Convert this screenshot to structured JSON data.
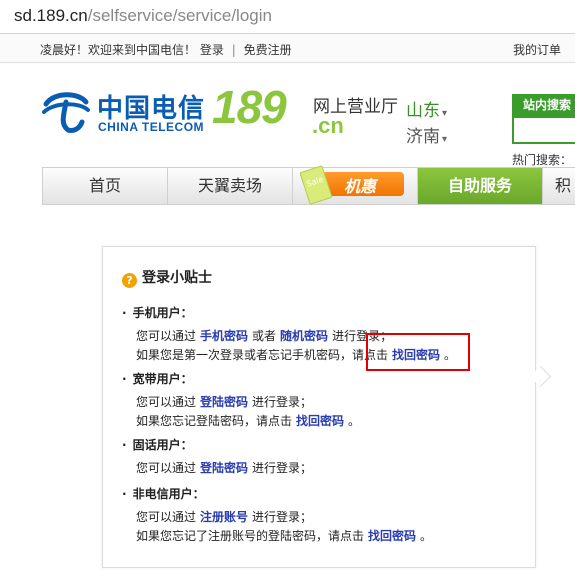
{
  "browser": {
    "host": "sd.189.cn",
    "path": "/selfservice/service/login"
  },
  "topbar": {
    "greeting": "凌晨好！欢迎来到中国电信！",
    "login": "登录",
    "separator": "|",
    "register": "免费注册",
    "my_orders": "我的订单"
  },
  "logo": {
    "cn_name": "中国电信",
    "en_name": "CHINA TELECOM",
    "number": "189",
    "hall": "网上营业厅",
    "domain": ".cn"
  },
  "location": {
    "province": "山东",
    "city": "济南"
  },
  "search": {
    "tab_label": "站内搜索",
    "hot_label": "热门搜索："
  },
  "nav": {
    "items": [
      "首页",
      "天翼卖场",
      "自助服务",
      "积"
    ],
    "promo": "机惠",
    "promo_card": "Sale"
  },
  "tips": {
    "title": "登录小贴士",
    "mobile": {
      "title": "手机用户：",
      "l1_pre": "您可以通过",
      "l1_link1": "手机密码",
      "l1_mid": "或者",
      "l1_link2": "随机密码",
      "l1_post": "进行登录；",
      "l2_pre": "如果您是第一次登录或者忘记手机密码，请点击",
      "l2_link": "找回密码",
      "l2_post": "。"
    },
    "broadband": {
      "title": "宽带用户：",
      "l1_pre": "您可以通过",
      "l1_link": "登陆密码",
      "l1_post": "进行登录；",
      "l2_pre": "如果您忘记登陆密码，请点击",
      "l2_link": "找回密码",
      "l2_post": "。"
    },
    "landline": {
      "title": "固话用户：",
      "l1_pre": "您可以通过",
      "l1_link": "登陆密码",
      "l1_post": "进行登录；"
    },
    "non_telecom": {
      "title": "非电信用户：",
      "l1_pre": "您可以通过",
      "l1_link": "注册账号",
      "l1_post": "进行登录；",
      "l2_pre": "如果您忘记了注册账号的登陆密码，请点击",
      "l2_link": "找回密码",
      "l2_post": "。"
    }
  },
  "colors": {
    "brand_blue": "#0b5db3",
    "brand_green": "#8cc63f",
    "link": "#2a3db0",
    "highlight": "#e00000"
  }
}
